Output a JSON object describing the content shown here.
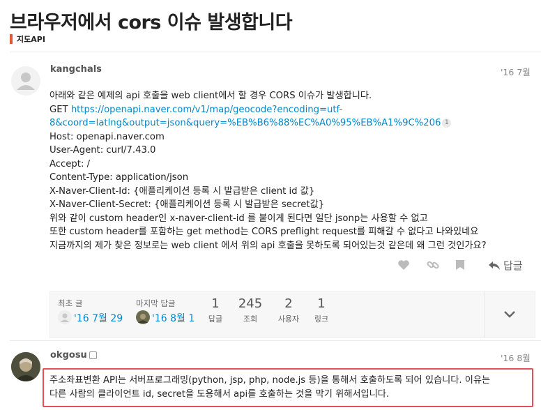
{
  "topic": {
    "title": "브라우저에서 cors 이슈 발생합니다",
    "category": "지도API",
    "category_color": "#e45735"
  },
  "post1": {
    "username": "kangchals",
    "date": "'16 7월",
    "avatar_icon": "default-user-icon",
    "lines": [
      "아래와 같은 예제의 api 호출을 web client에서 할 경우 CORS 이슈가 발생합니다.",
      "GET ",
      "Host: openapi.naver.com",
      "User-Agent: curl/7.43.0",
      "Accept: /",
      "Content-Type: application/json",
      "X-Naver-Client-Id: {애플리케이션 등록 시 발급받은 client id 값}",
      "X-Naver-Client-Secret: {애플리케이션 등록 시 발급받은 secret값}",
      "위와 같이 custom header인 x-naver-client-id 를 붙이게 된다면 일단 jsonp는 사용할 수 없고",
      "또한 custom header를 포함하는 get method는 CORS preflight request를 피해갈 수 없다고 나와있네요",
      "지금까지의 제가 찾은 정보로는 web client 에서 위의 api 호출을 못하도록 되어있는것 같은데 왜 그런 것인가요?"
    ],
    "link_line1": "https://openapi.naver.com/v1/map/geocode?encoding=utf-",
    "link_line2": "8&coord=latlng&output=json&query=%EB%B6%88%EC%A0%95%EB%A1%9C%206",
    "link_clicks": "1",
    "reply_label": "답글"
  },
  "topic_map": {
    "created_label": "최초 글",
    "created_value": "'16 7월 29",
    "last_reply_label": "마지막 답글",
    "last_reply_value": "'16 8월 1",
    "stats": [
      {
        "num": "1",
        "label": "답글"
      },
      {
        "num": "245",
        "label": "조회"
      },
      {
        "num": "2",
        "label": "사용자"
      },
      {
        "num": "1",
        "label": "링크"
      }
    ]
  },
  "post2": {
    "username": "okgosu",
    "date": "'16 8월",
    "lines": [
      "주소좌표변환 API는 서버프로그래밍(python, jsp, php, node.js 등)을 통해서 호출하도록 되어 있습니다. 이유는",
      "다른 사람의 클라이언트 id, secret을 도용해서 api를 호출하는 것을 막기 위해서입니다."
    ],
    "highlight_color": "#e3505a"
  }
}
